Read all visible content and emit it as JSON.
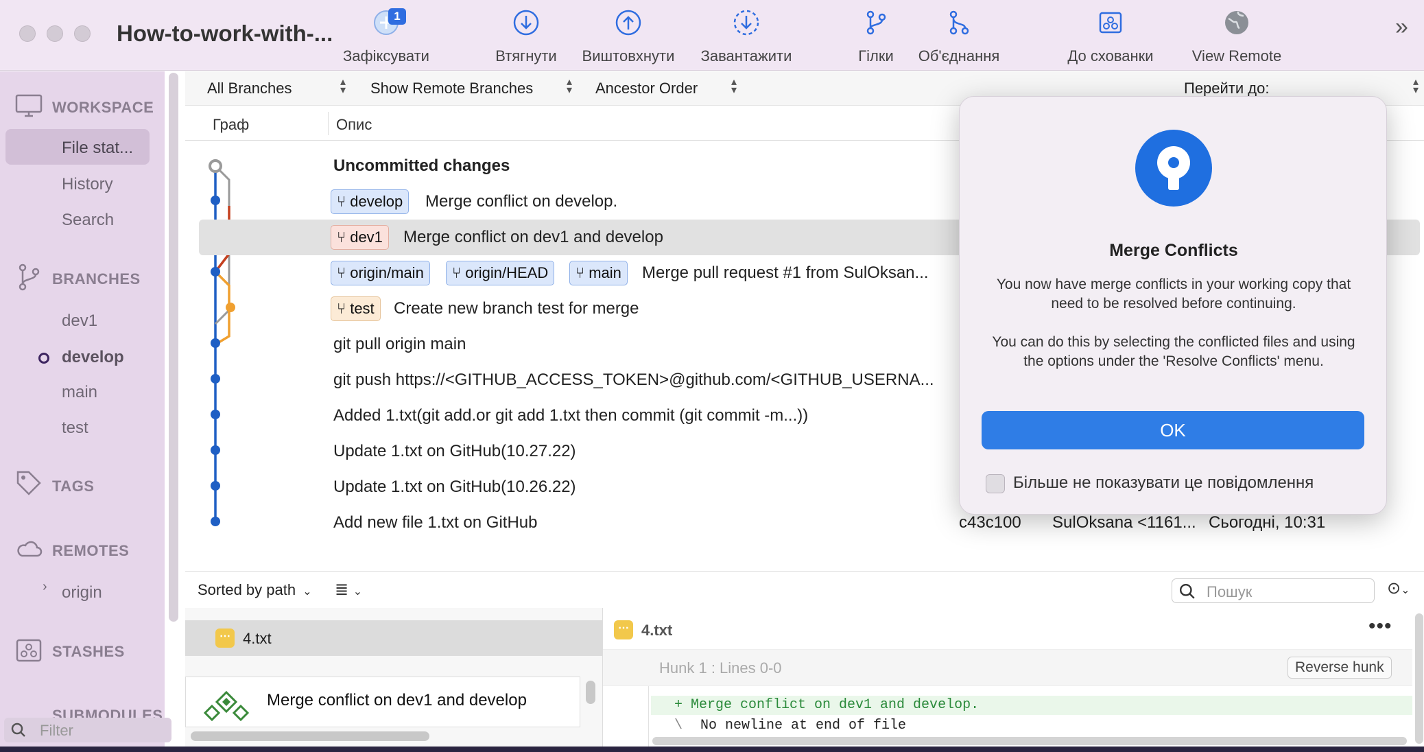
{
  "window": {
    "title": "How-to-work-with-..."
  },
  "toolbar": {
    "commit_label": "Зафіксувати",
    "commit_badge": "1",
    "pull_label": "Втягнути",
    "push_label": "Виштовхнути",
    "fetch_label": "Завантажити",
    "branch_label": "Гілки",
    "merge_label": "Об'єднання",
    "stash_label": "До схованки",
    "view_remote_label": "View Remote",
    "overflow": "»"
  },
  "sidebar": {
    "workspace": "WORKSPACE",
    "workspace_items": [
      "File stat...",
      "History",
      "Search"
    ],
    "branches": "BRANCHES",
    "branch_items": [
      "dev1",
      "develop",
      "main",
      "test"
    ],
    "current_branch": "develop",
    "tags": "TAGS",
    "remotes": "REMOTES",
    "remote_items": [
      "origin"
    ],
    "stashes": "STASHES",
    "submodules": "SUBMODULES",
    "filter_placeholder": "Filter"
  },
  "filters": {
    "branches": "All Branches",
    "remote": "Show Remote Branches",
    "order": "Ancestor Order",
    "jump_to": "Перейти до:"
  },
  "columns": {
    "graph": "Граф",
    "description": "Опис"
  },
  "commits": [
    {
      "message": "Uncommitted changes",
      "bold": true
    },
    {
      "tags": [
        "develop"
      ],
      "message": "Merge conflict on develop."
    },
    {
      "tags": [
        "dev1"
      ],
      "message": "Merge conflict on dev1 and develop"
    },
    {
      "tags": [
        "origin/main",
        "origin/HEAD",
        "main"
      ],
      "message": "Merge pull request #1 from SulOksan..."
    },
    {
      "tags": [
        "test"
      ],
      "message": "Create new branch test for merge"
    },
    {
      "message": "git pull origin main"
    },
    {
      "message": "git push https://<GITHUB_ACCESS_TOKEN>@github.com/<GITHUB_USERNA..."
    },
    {
      "message": "Added 1.txt(git add.or git add 1.txt then commit (git commit -m...))"
    },
    {
      "message": "Update 1.txt on GitHub(10.27.22)"
    },
    {
      "message": "Update 1.txt on GitHub(10.26.22)"
    },
    {
      "message": "Add new file 1.txt on GitHub",
      "hash": "c43c100",
      "author": "SulOksana <1161...",
      "date": "Сьогодні, 10:31"
    }
  ],
  "lower": {
    "sort_label": "Sorted by path",
    "search_placeholder": "Пошук",
    "file_name": "4.txt",
    "commit_preview": "Merge conflict on dev1 and develop",
    "diff_file": "4.txt",
    "hunk_label": "Hunk 1 : Lines 0-0",
    "reverse_hunk": "Reverse hunk",
    "diff_added": "+ Merge conflict on dev1 and develop.",
    "diff_nonewline_marker": "\\",
    "diff_nonewline": "No newline at end of file"
  },
  "dialog": {
    "title": "Merge Conflicts",
    "para1": "You now have merge conflicts in your working copy that need to be resolved before continuing.",
    "para2": "You can do this by selecting the conflicted files and using the options under the 'Resolve Conflicts' menu.",
    "ok": "OK",
    "dont_show": "Більше не показувати це повідомлення"
  },
  "colors": {
    "accent": "#2f7de6",
    "graph_blue": "#1f5fc4",
    "graph_red": "#c4401f",
    "graph_orange": "#f0a030",
    "graph_grey": "#9a9a9a"
  }
}
